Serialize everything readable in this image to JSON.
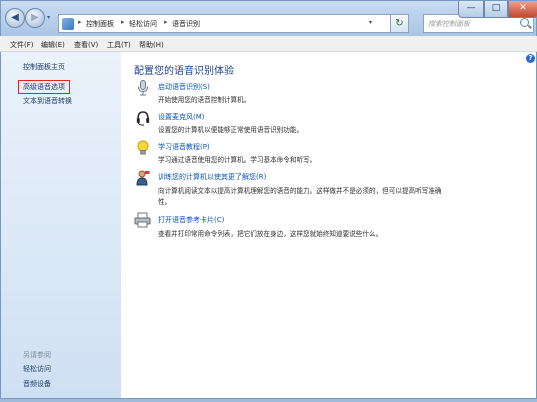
{
  "window": {
    "back_icon": "arrow-left-icon",
    "forward_icon": "arrow-right-icon",
    "minimize": "—",
    "maximize": "□",
    "close": "✕"
  },
  "address": {
    "crumbs": [
      "控制面板",
      "轻松访问",
      "语音识别"
    ],
    "separator": "▸"
  },
  "search": {
    "placeholder": "搜索控制面板"
  },
  "menu": [
    "文件(F)",
    "编辑(E)",
    "查看(V)",
    "工具(T)",
    "帮助(H)"
  ],
  "sidebar": {
    "items": [
      {
        "label": "控制面板主页"
      },
      {
        "label": "高级语音选项"
      },
      {
        "label": "文本到语音转换"
      }
    ],
    "see_also_title": "另请参阅",
    "see_also": [
      {
        "label": "轻松访问"
      },
      {
        "label": "音频设备"
      }
    ]
  },
  "main": {
    "heading": "配置您的语音识别体验",
    "items": [
      {
        "icon": "microphone-icon",
        "title": "启动语音识别(S)",
        "desc": "开始使用您的语音控制计算机。",
        "desc2": ""
      },
      {
        "icon": "headset-icon",
        "title": "设置麦克风(M)",
        "desc": "设置您的计算机以便能够正常使用语音识别功能。",
        "desc2": ""
      },
      {
        "icon": "lightbulb-icon",
        "title": "学习语音教程(P)",
        "desc": "学习通过语音使用您的计算机。学习基本命令和听写。",
        "desc2": ""
      },
      {
        "icon": "user-train-icon",
        "title": "训练您的计算机以使其更了解您(R)",
        "desc": "向计算机阅读文本以提高计算机理解您的语音的能力。这样做并不是必须的，但可以提高听写准确",
        "desc2": "性。"
      },
      {
        "icon": "printer-icon",
        "title": "打开语音参考卡片(C)",
        "desc": "查看并打印常用命令列表，把它们放在身边，这样您就始终知道要说些什么。",
        "desc2": ""
      }
    ]
  }
}
